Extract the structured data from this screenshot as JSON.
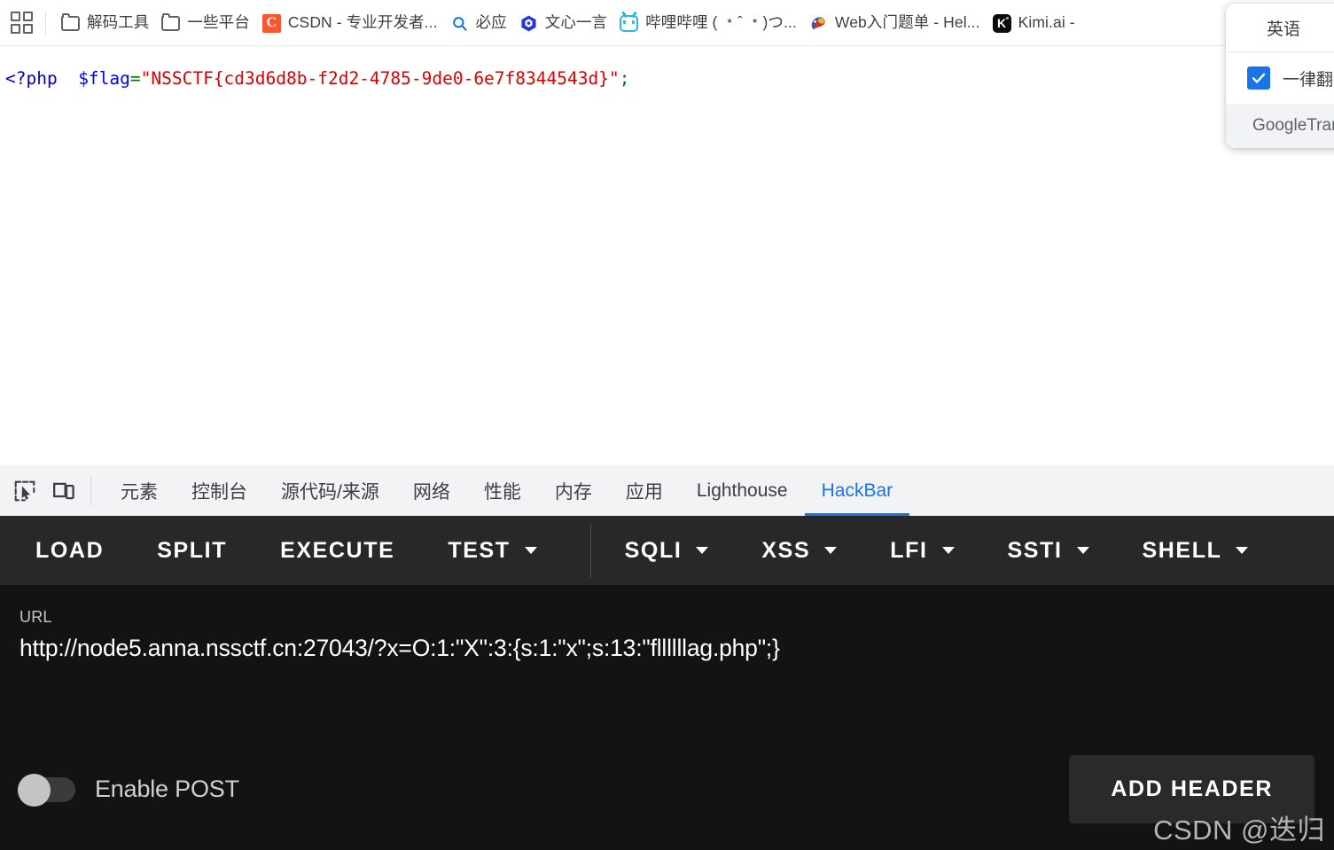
{
  "bookmark_bar": {
    "apps_icon": "apps-grid-icon",
    "items": [
      {
        "icon": "folder-icon",
        "label": "解码工具"
      },
      {
        "icon": "folder-icon",
        "label": "一些平台"
      },
      {
        "icon": "csdn-icon",
        "label": "CSDN - 专业开发者...",
        "icon_text": "C",
        "icon_color": "#fc5531"
      },
      {
        "icon": "bing-search-icon",
        "label": "必应"
      },
      {
        "icon": "wenxin-yiyan-icon",
        "label": "文心一言"
      },
      {
        "icon": "bilibili-icon",
        "label": "哔哩哔哩 ( ﹡ˆ ﹡)つ..."
      },
      {
        "icon": "hello-ctf-icon",
        "label": "Web入门题单 - Hel..."
      },
      {
        "icon": "kimi-icon",
        "label": "Kimi.ai -",
        "icon_text": "K"
      }
    ]
  },
  "translate_popup": {
    "language": "英语",
    "always_translate_label": "一律翻译",
    "checkbox_checked": true,
    "footer_brand": "Google",
    "footer_text": " Translate"
  },
  "page": {
    "code": {
      "php_open": "<?php",
      "spacer": "  ",
      "variable": "$flag",
      "equals": "=",
      "string": "\"NSSCTF{cd3d6d8b-f2d2-4785-9de0-6e7f8344543d}\"",
      "semicolon": ";"
    },
    "colors": {
      "php_tag": "#0000c8",
      "variable": "#0000ff",
      "string": "#dd0000",
      "operator": "#007700"
    }
  },
  "devtools": {
    "toolbar_icons": [
      {
        "name": "inspect-element-icon"
      },
      {
        "name": "device-toolbar-icon"
      }
    ],
    "tabs": [
      {
        "label": "元素",
        "active": false
      },
      {
        "label": "控制台",
        "active": false
      },
      {
        "label": "源代码/来源",
        "active": false
      },
      {
        "label": "网络",
        "active": false
      },
      {
        "label": "性能",
        "active": false
      },
      {
        "label": "内存",
        "active": false
      },
      {
        "label": "应用",
        "active": false
      },
      {
        "label": "Lighthouse",
        "active": false
      },
      {
        "label": "HackBar",
        "active": true
      }
    ],
    "active_tab": "HackBar",
    "accent_color": "#1a73e8"
  },
  "hackbar": {
    "actions": [
      {
        "label": "LOAD",
        "dropdown": false
      },
      {
        "label": "SPLIT",
        "dropdown": false
      },
      {
        "label": "EXECUTE",
        "dropdown": false
      },
      {
        "label": "TEST",
        "dropdown": true
      },
      {
        "label": "SQLI",
        "dropdown": true
      },
      {
        "label": "XSS",
        "dropdown": true
      },
      {
        "label": "LFI",
        "dropdown": true
      },
      {
        "label": "SSTI",
        "dropdown": true
      },
      {
        "label": "SHELL",
        "dropdown": true
      }
    ],
    "url_label": "URL",
    "url_value": "http://node5.anna.nssctf.cn:27043/?x=O:1:\"X\":3:{s:1:\"x\";s:13:\"fllllllag.php\";}",
    "post_toggle_label": "Enable POST",
    "post_toggle_on": false,
    "add_header_label": "ADD HEADER"
  },
  "watermark": "CSDN @迭归"
}
